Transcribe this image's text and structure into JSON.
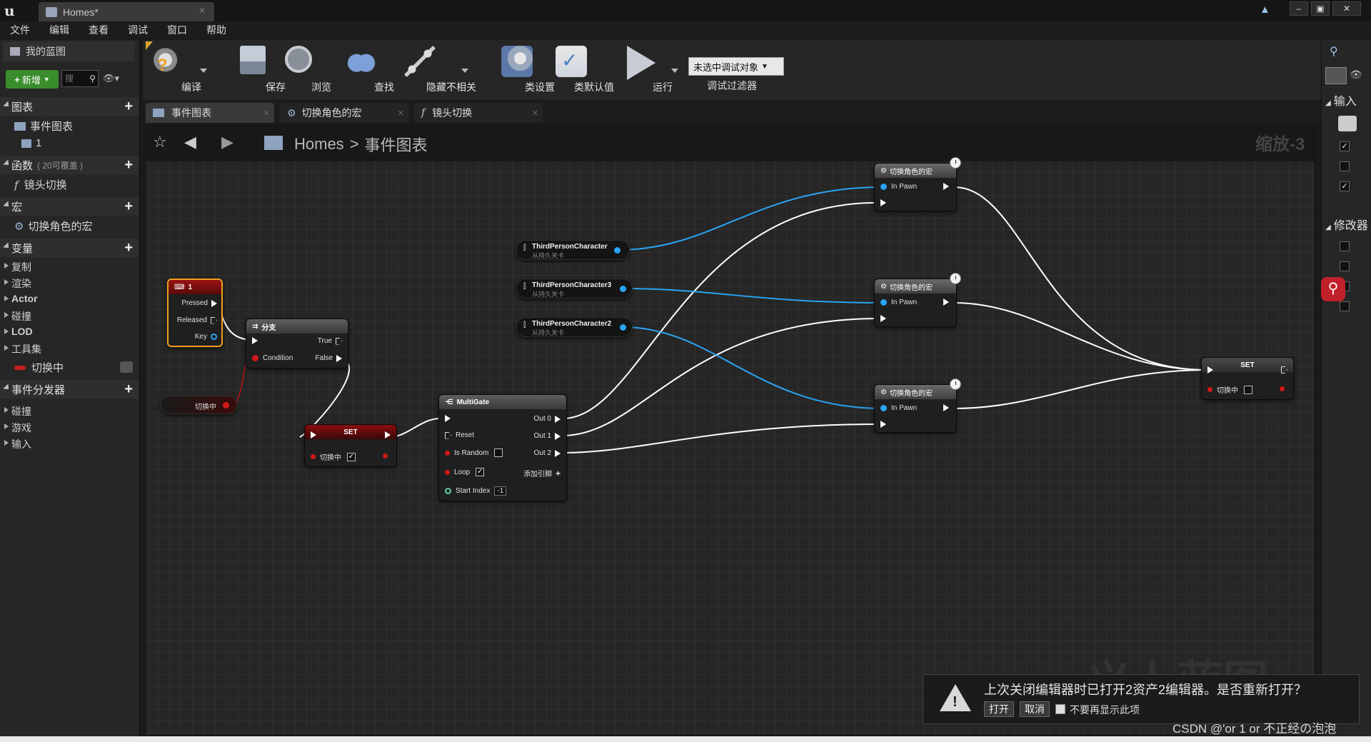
{
  "window": {
    "title_tab": "Homes*"
  },
  "menu": [
    "文件",
    "编辑",
    "查看",
    "调试",
    "窗口",
    "帮助"
  ],
  "left_panel": {
    "tab_title": "我的蓝图",
    "new_button": "新增",
    "search_placeholder": "搜",
    "sections": {
      "graphs": "图表",
      "functions": "函数",
      "functions_sub": "( 20可覆盖 )",
      "macros": "宏",
      "variables": "变量",
      "dispatchers": "事件分发器"
    },
    "graph_items": [
      "事件图表",
      "1"
    ],
    "function_items": [
      "镜头切换"
    ],
    "macro_items": [
      "切换角色的宏"
    ],
    "variable_categories": [
      "复制",
      "渲染",
      "Actor",
      "碰撞",
      "LOD",
      "工具集"
    ],
    "variable_items": [
      "切换中"
    ],
    "dispatcher_categories": [
      "碰撞",
      "游戏",
      "输入"
    ]
  },
  "toolbar": {
    "compile": "编译",
    "save": "保存",
    "browse": "浏览",
    "find": "查找",
    "hide_unrelated": "隐藏不相关",
    "class_settings": "类设置",
    "class_defaults": "类默认值",
    "run": "运行",
    "debug_select": "未选中调试对象",
    "debug_filter": "调试过滤器"
  },
  "graph_tabs": [
    "事件图表",
    "切换角色的宏",
    "镜头切换"
  ],
  "breadcrumb": {
    "root": "Homes",
    "sep": ">",
    "current": "事件图表"
  },
  "zoom": "缩放-3",
  "watermark": "义上蓝图",
  "nodes": {
    "key_event": {
      "title": "1",
      "pins": [
        "Pressed",
        "Released",
        "Key"
      ]
    },
    "branch": {
      "title": "分支",
      "cond": "Condition",
      "true": "True",
      "false": "False"
    },
    "get_var": {
      "label": "切换中"
    },
    "set1": {
      "title": "SET",
      "pin": "切换中",
      "checked": true
    },
    "multigate": {
      "title": "MultiGate",
      "reset": "Reset",
      "is_random": "Is Random",
      "loop": "Loop",
      "start_index": "Start Index",
      "start_index_val": "-1",
      "outs": [
        "Out 0",
        "Out 1",
        "Out 2"
      ],
      "add_pin": "添加引脚"
    },
    "vars": [
      {
        "name": "ThirdPersonCharacter",
        "sub": "从持久关卡"
      },
      {
        "name": "ThirdPersonCharacter3",
        "sub": "从持久关卡"
      },
      {
        "name": "ThirdPersonCharacter2",
        "sub": "从持久关卡"
      }
    ],
    "macro": {
      "title": "切换角色的宏",
      "pin": "In Pawn"
    },
    "set2": {
      "title": "SET",
      "pin": "切换中",
      "checked": false
    }
  },
  "right_panel": {
    "inputs": "输入",
    "modifiers": "修改器"
  },
  "notification": {
    "message": "上次关闭编辑器时已打开2资产2编辑器。是否重新打开？",
    "open": "打开",
    "cancel": "取消",
    "dont_show": "不要再显示此项"
  },
  "footer_watermark": "CSDN @'or 1 or 不正经の泡泡",
  "colors": {
    "accent_green": "#3a8d2c",
    "exec_wire": "#ffffff",
    "object_wire": "#2aa4f4",
    "bool_pin": "#d01818"
  }
}
